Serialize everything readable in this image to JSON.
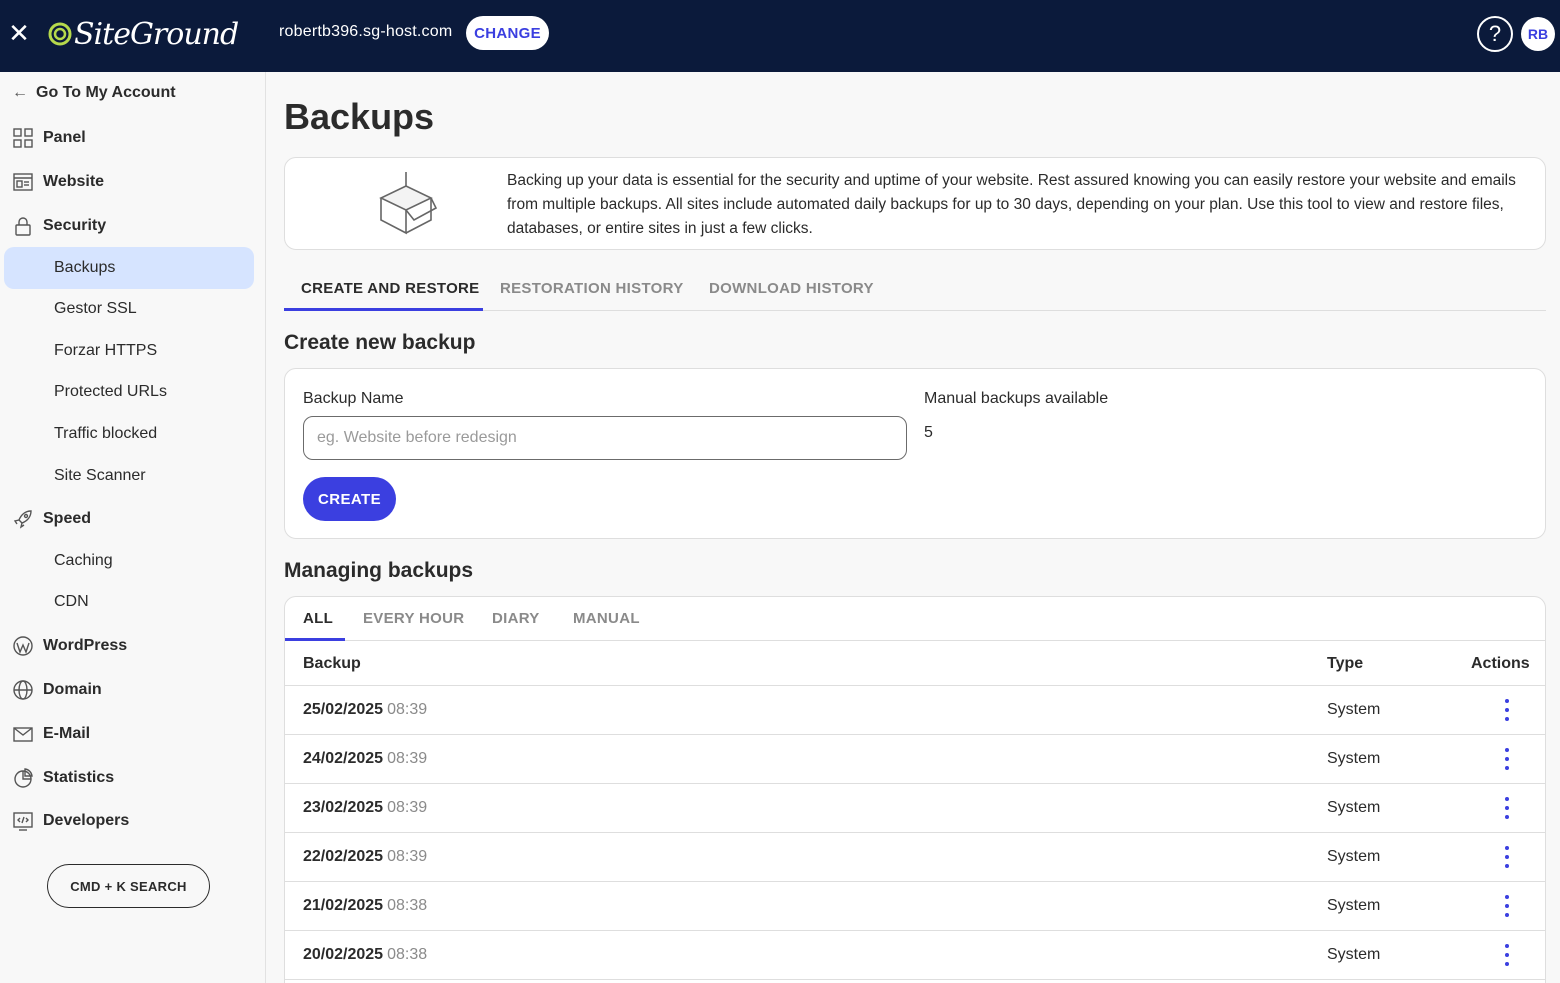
{
  "topbar": {
    "logo_text": "SiteGround",
    "domain": "robertb396.sg-host.com",
    "change_label": "CHANGE",
    "help_label": "?",
    "avatar_initials": "RB"
  },
  "sidebar": {
    "back_label": "Go To My Account",
    "items": [
      {
        "label": "Panel",
        "icon": "grid-icon"
      },
      {
        "label": "Website",
        "icon": "website-icon"
      },
      {
        "label": "Security",
        "icon": "lock-icon"
      },
      {
        "label": "Speed",
        "icon": "rocket-icon"
      },
      {
        "label": "WordPress",
        "icon": "wordpress-icon"
      },
      {
        "label": "Domain",
        "icon": "globe-icon"
      },
      {
        "label": "E-Mail",
        "icon": "mail-icon"
      },
      {
        "label": "Statistics",
        "icon": "pie-chart-icon"
      },
      {
        "label": "Developers",
        "icon": "code-icon"
      }
    ],
    "security_sub": [
      "Backups",
      "Gestor SSL",
      "Forzar HTTPS",
      "Protected URLs",
      "Traffic blocked",
      "Site Scanner"
    ],
    "speed_sub": [
      "Caching",
      "CDN"
    ],
    "search_label": "CMD + K SEARCH"
  },
  "main": {
    "title": "Backups",
    "info_text": "Backing up your data is essential for the security and uptime of your website. Rest assured knowing you can easily restore your website and emails from multiple backups. All sites include automated daily backups for up to 30 days, depending on your plan. Use this tool to view and restore files, databases, or entire sites in just a few clicks.",
    "tabs": [
      "CREATE AND RESTORE",
      "RESTORATION HISTORY",
      "DOWNLOAD HISTORY"
    ],
    "create": {
      "section_title": "Create new backup",
      "name_label": "Backup Name",
      "name_placeholder": "eg. Website before redesign",
      "name_value": "",
      "manual_label": "Manual backups available",
      "manual_count": "5",
      "create_label": "CREATE"
    },
    "manage": {
      "section_title": "Managing backups",
      "filters": [
        "ALL",
        "EVERY HOUR",
        "DIARY",
        "MANUAL"
      ],
      "columns": {
        "backup": "Backup",
        "type": "Type",
        "actions": "Actions"
      },
      "rows": [
        {
          "date": "25/02/2025",
          "time": "08:39",
          "type": "System"
        },
        {
          "date": "24/02/2025",
          "time": "08:39",
          "type": "System"
        },
        {
          "date": "23/02/2025",
          "time": "08:39",
          "type": "System"
        },
        {
          "date": "22/02/2025",
          "time": "08:39",
          "type": "System"
        },
        {
          "date": "21/02/2025",
          "time": "08:38",
          "type": "System"
        },
        {
          "date": "20/02/2025",
          "time": "08:38",
          "type": "System"
        }
      ]
    }
  },
  "colors": {
    "topbar": "#0b1a3b",
    "accent": "#3b3fe0",
    "active_nav_bg": "#d6e4ff"
  }
}
